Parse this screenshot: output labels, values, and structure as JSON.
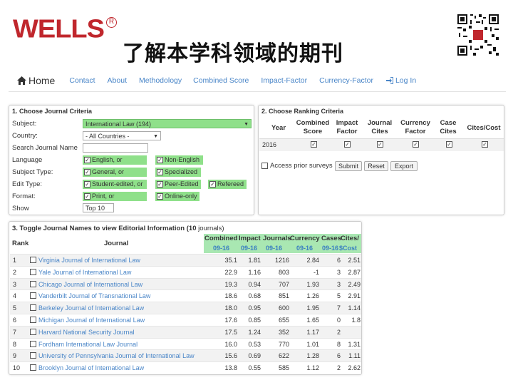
{
  "slide": {
    "logo": "WELLS",
    "logo_mark": "R",
    "title": "了解本学科领域的期刊"
  },
  "nav": {
    "home": "Home",
    "items": [
      "Contact",
      "About",
      "Methodology",
      "Combined Score",
      "Impact-Factor",
      "Currency-Factor"
    ],
    "login": "Log In",
    "accent": "#4a86c8"
  },
  "criteria": {
    "title": "1. Choose Journal Criteria",
    "subject_label": "Subject:",
    "subject_value": "International Law (194)",
    "country_label": "Country:",
    "country_value": "- All Countries -",
    "search_label": "Search Journal Name",
    "language_label": "Language",
    "language_opts": [
      "English, or",
      "Non-English"
    ],
    "subject_type_label": "Subject Type:",
    "subject_type_opts": [
      "General, or",
      "Specialized"
    ],
    "edit_type_label": "Edit Type:",
    "edit_type_opts": [
      "Student-edited, or",
      "Peer-Edited",
      "Refereed"
    ],
    "format_label": "Format:",
    "format_opts": [
      "Print, or",
      "Online-only"
    ],
    "show_label": "Show",
    "show_value": "Top 10",
    "highlight": "#8fe08a"
  },
  "ranking": {
    "title": "2. Choose Ranking Criteria",
    "headers": [
      "Year",
      "Combined Score",
      "Impact Factor",
      "Journal Cites",
      "Currency Factor",
      "Case Cites",
      "Cites/Cost"
    ],
    "year": "2016",
    "prior_surveys": "Access prior surveys",
    "submit": "Submit",
    "reset": "Reset",
    "export": "Export"
  },
  "results": {
    "title_prefix": "3. Toggle Journal Names to view Editorial Information",
    "count": "(10",
    "count_suffix": "journals)",
    "col_rank": "Rank",
    "col_journal": "Journal",
    "col_heads": [
      "Combined",
      "Impact",
      "Journals",
      "Currency",
      "Cases",
      "Cites/"
    ],
    "col_subs": [
      "09-16",
      "09-16",
      "09-16",
      "09-16",
      "09-16",
      "$Cost"
    ],
    "rows": [
      {
        "rank": "1",
        "journal": "Virginia Journal of International Law",
        "combined": "35.1",
        "impact": "1.81",
        "journals": "1216",
        "currency": "2.84",
        "cases": "6",
        "cites": "2.51"
      },
      {
        "rank": "2",
        "journal": "Yale Journal of International Law",
        "combined": "22.9",
        "impact": "1.16",
        "journals": "803",
        "currency": "-1",
        "cases": "3",
        "cites": "2.87"
      },
      {
        "rank": "3",
        "journal": "Chicago Journal of International Law",
        "combined": "19.3",
        "impact": "0.94",
        "journals": "707",
        "currency": "1.93",
        "cases": "3",
        "cites": "2.49"
      },
      {
        "rank": "4",
        "journal": "Vanderbilt Journal of Transnational Law",
        "combined": "18.6",
        "impact": "0.68",
        "journals": "851",
        "currency": "1.26",
        "cases": "5",
        "cites": "2.91"
      },
      {
        "rank": "5",
        "journal": "Berkeley Journal of International Law",
        "combined": "18.0",
        "impact": "0.95",
        "journals": "600",
        "currency": "1.95",
        "cases": "7",
        "cites": "1.14"
      },
      {
        "rank": "6",
        "journal": "Michigan Journal of International Law",
        "combined": "17.6",
        "impact": "0.85",
        "journals": "655",
        "currency": "1.65",
        "cases": "0",
        "cites": "1.8"
      },
      {
        "rank": "7",
        "journal": "Harvard National Security Journal",
        "combined": "17.5",
        "impact": "1.24",
        "journals": "352",
        "currency": "1.17",
        "cases": "2",
        "cites": ""
      },
      {
        "rank": "8",
        "journal": "Fordham International Law Journal",
        "combined": "16.0",
        "impact": "0.53",
        "journals": "770",
        "currency": "1.01",
        "cases": "8",
        "cites": "1.31"
      },
      {
        "rank": "9",
        "journal": "University of Pennsylvania Journal of International Law",
        "combined": "15.6",
        "impact": "0.69",
        "journals": "622",
        "currency": "1.28",
        "cases": "6",
        "cites": "1.11"
      },
      {
        "rank": "10",
        "journal": "Brooklyn Journal of International Law",
        "combined": "13.8",
        "impact": "0.55",
        "journals": "585",
        "currency": "1.12",
        "cases": "2",
        "cites": "2.62"
      }
    ],
    "header_color": "#a9e7b2"
  }
}
